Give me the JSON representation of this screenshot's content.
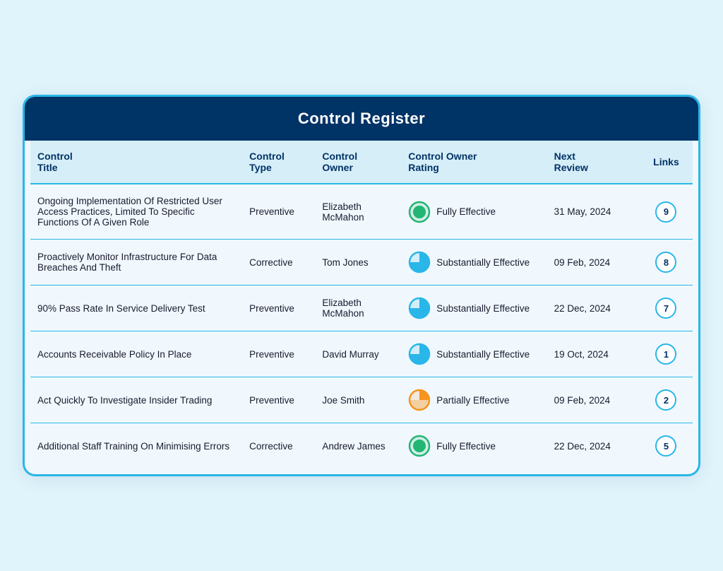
{
  "header": {
    "title": "Control Register"
  },
  "columns": [
    {
      "key": "title",
      "label": "Control\nTitle"
    },
    {
      "key": "type",
      "label": "Control\nType"
    },
    {
      "key": "owner",
      "label": "Control\nOwner"
    },
    {
      "key": "rating",
      "label": "Control Owner\nRating"
    },
    {
      "key": "review",
      "label": "Next\nReview"
    },
    {
      "key": "links",
      "label": "Links"
    }
  ],
  "rows": [
    {
      "title": "Ongoing Implementation Of Restricted User Access Practices, Limited To Specific Functions Of A Given Role",
      "type": "Preventive",
      "owner": "Elizabeth McMahon",
      "rating_label": "Fully Effective",
      "rating_type": "full",
      "rating_color": "#22b573",
      "review": "31 May, 2024",
      "links": "9"
    },
    {
      "title": "Proactively Monitor Infrastructure For Data Breaches And Theft",
      "type": "Corrective",
      "owner": "Tom Jones",
      "rating_label": "Substantially Effective",
      "rating_type": "substantial",
      "rating_color": "#29b6e8",
      "review": "09 Feb, 2024",
      "links": "8"
    },
    {
      "title": "90% Pass Rate In Service Delivery Test",
      "type": "Preventive",
      "owner": "Elizabeth McMahon",
      "rating_label": "Substantially Effective",
      "rating_type": "substantial",
      "rating_color": "#29b6e8",
      "review": "22 Dec, 2024",
      "links": "7"
    },
    {
      "title": "Accounts Receivable Policy In Place",
      "type": "Preventive",
      "owner": "David Murray",
      "rating_label": "Substantially Effective",
      "rating_type": "substantial",
      "rating_color": "#29b6e8",
      "review": "19 Oct, 2024",
      "links": "1"
    },
    {
      "title": "Act Quickly To Investigate Insider Trading",
      "type": "Preventive",
      "owner": "Joe Smith",
      "rating_label": "Partially Effective",
      "rating_type": "partial",
      "rating_color": "#f7941d",
      "review": "09 Feb, 2024",
      "links": "2"
    },
    {
      "title": "Additional Staff Training On Minimising Errors",
      "type": "Corrective",
      "owner": "Andrew James",
      "rating_label": "Fully Effective",
      "rating_type": "full",
      "rating_color": "#22b573",
      "review": "22 Dec, 2024",
      "links": "5"
    }
  ]
}
